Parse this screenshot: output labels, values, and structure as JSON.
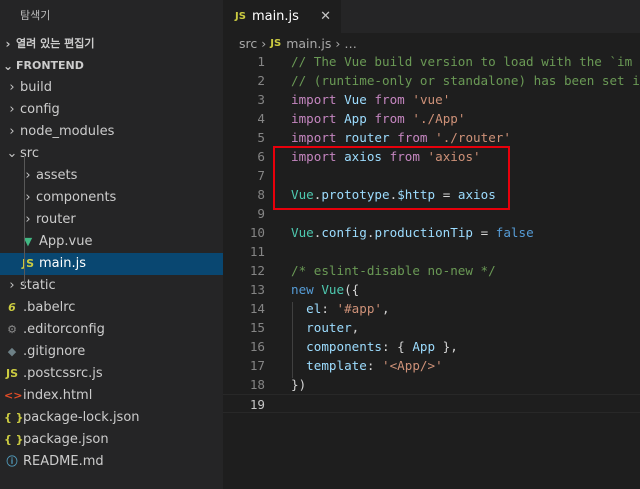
{
  "explorer": {
    "title": "탐색기",
    "open_editors": "열려 있는 편집기",
    "project": "FRONTEND",
    "tree": [
      {
        "label": "build",
        "type": "folder",
        "depth": 1,
        "expanded": false
      },
      {
        "label": "config",
        "type": "folder",
        "depth": 1,
        "expanded": false
      },
      {
        "label": "node_modules",
        "type": "folder",
        "depth": 1,
        "expanded": false
      },
      {
        "label": "src",
        "type": "folder",
        "depth": 1,
        "expanded": true
      },
      {
        "label": "assets",
        "type": "folder",
        "depth": 2,
        "expanded": false
      },
      {
        "label": "components",
        "type": "folder",
        "depth": 2,
        "expanded": false
      },
      {
        "label": "router",
        "type": "folder",
        "depth": 2,
        "expanded": false
      },
      {
        "label": "App.vue",
        "type": "vue",
        "depth": 2
      },
      {
        "label": "main.js",
        "type": "js",
        "depth": 2,
        "active": true
      },
      {
        "label": "static",
        "type": "folder",
        "depth": 1,
        "expanded": false
      },
      {
        "label": ".babelrc",
        "type": "babel",
        "depth": 1
      },
      {
        "label": ".editorconfig",
        "type": "gear",
        "depth": 1
      },
      {
        "label": ".gitignore",
        "type": "git",
        "depth": 1
      },
      {
        "label": ".postcssrc.js",
        "type": "js",
        "depth": 1
      },
      {
        "label": "index.html",
        "type": "html",
        "depth": 1
      },
      {
        "label": "package-lock.json",
        "type": "json",
        "depth": 1
      },
      {
        "label": "package.json",
        "type": "json",
        "depth": 1
      },
      {
        "label": "README.md",
        "type": "info",
        "depth": 1
      }
    ]
  },
  "icons": {
    "js": "JS",
    "json": "{ }",
    "vue": "▼",
    "babel": "6",
    "gear": "⚙",
    "git": "◆",
    "html": "<>",
    "info": "ⓘ",
    "chevron_right": "›",
    "chevron_down": "⌄",
    "close": "✕"
  },
  "editor": {
    "tab": {
      "label": "main.js",
      "icon": "JS",
      "close": "✕"
    },
    "breadcrumb": {
      "folder": "src",
      "file": "main.js",
      "more": "…",
      "sep": "›"
    },
    "lines": [
      {
        "n": "1",
        "tokens": [
          [
            "cm",
            "// The Vue build version to load with the `im"
          ]
        ]
      },
      {
        "n": "2",
        "tokens": [
          [
            "cm",
            "// (runtime-only or standalone) has been set i"
          ]
        ]
      },
      {
        "n": "3",
        "tokens": [
          [
            "kw",
            "import"
          ],
          [
            "pun",
            " "
          ],
          [
            "var",
            "Vue"
          ],
          [
            "pun",
            " "
          ],
          [
            "kw",
            "from"
          ],
          [
            "pun",
            " "
          ],
          [
            "str",
            "'vue'"
          ]
        ]
      },
      {
        "n": "4",
        "tokens": [
          [
            "kw",
            "import"
          ],
          [
            "pun",
            " "
          ],
          [
            "var",
            "App"
          ],
          [
            "pun",
            " "
          ],
          [
            "kw",
            "from"
          ],
          [
            "pun",
            " "
          ],
          [
            "str",
            "'./App'"
          ]
        ]
      },
      {
        "n": "5",
        "tokens": [
          [
            "kw",
            "import"
          ],
          [
            "pun",
            " "
          ],
          [
            "var",
            "router"
          ],
          [
            "pun",
            " "
          ],
          [
            "kw",
            "from"
          ],
          [
            "pun",
            " "
          ],
          [
            "str",
            "'./router'"
          ]
        ]
      },
      {
        "n": "6",
        "tokens": [
          [
            "kw",
            "import"
          ],
          [
            "pun",
            " "
          ],
          [
            "var",
            "axios"
          ],
          [
            "pun",
            " "
          ],
          [
            "kw",
            "from"
          ],
          [
            "pun",
            " "
          ],
          [
            "str",
            "'axios'"
          ]
        ]
      },
      {
        "n": "7",
        "tokens": []
      },
      {
        "n": "8",
        "tokens": [
          [
            "cls",
            "Vue"
          ],
          [
            "pun",
            "."
          ],
          [
            "var",
            "prototype"
          ],
          [
            "pun",
            "."
          ],
          [
            "var",
            "$http"
          ],
          [
            "pun",
            " = "
          ],
          [
            "var",
            "axios"
          ]
        ]
      },
      {
        "n": "9",
        "tokens": []
      },
      {
        "n": "10",
        "tokens": [
          [
            "cls",
            "Vue"
          ],
          [
            "pun",
            "."
          ],
          [
            "var",
            "config"
          ],
          [
            "pun",
            "."
          ],
          [
            "var",
            "productionTip"
          ],
          [
            "pun",
            " = "
          ],
          [
            "kw2",
            "false"
          ]
        ]
      },
      {
        "n": "11",
        "tokens": []
      },
      {
        "n": "12",
        "tokens": [
          [
            "cm",
            "/* eslint-disable no-new */"
          ]
        ]
      },
      {
        "n": "13",
        "tokens": [
          [
            "kw2",
            "new"
          ],
          [
            "pun",
            " "
          ],
          [
            "cls",
            "Vue"
          ],
          [
            "pun",
            "({"
          ]
        ]
      },
      {
        "n": "14",
        "tokens": [
          [
            "pun",
            "  "
          ],
          [
            "var",
            "el"
          ],
          [
            "pun",
            ": "
          ],
          [
            "str",
            "'#app'"
          ],
          [
            "pun",
            ","
          ]
        ]
      },
      {
        "n": "15",
        "tokens": [
          [
            "pun",
            "  "
          ],
          [
            "var",
            "router"
          ],
          [
            "pun",
            ","
          ]
        ]
      },
      {
        "n": "16",
        "tokens": [
          [
            "pun",
            "  "
          ],
          [
            "var",
            "components"
          ],
          [
            "pun",
            ": { "
          ],
          [
            "var",
            "App"
          ],
          [
            "pun",
            " },"
          ]
        ]
      },
      {
        "n": "17",
        "tokens": [
          [
            "pun",
            "  "
          ],
          [
            "var",
            "template"
          ],
          [
            "pun",
            ": "
          ],
          [
            "str",
            "'<App/>'"
          ]
        ]
      },
      {
        "n": "18",
        "tokens": [
          [
            "pun",
            "})"
          ]
        ]
      },
      {
        "n": "19",
        "tokens": [],
        "current": true
      }
    ]
  },
  "colors": {
    "sidebar_bg": "#252526",
    "editor_bg": "#1e1e1e",
    "active_row": "#094771",
    "highlight_box": "#e8000b"
  }
}
